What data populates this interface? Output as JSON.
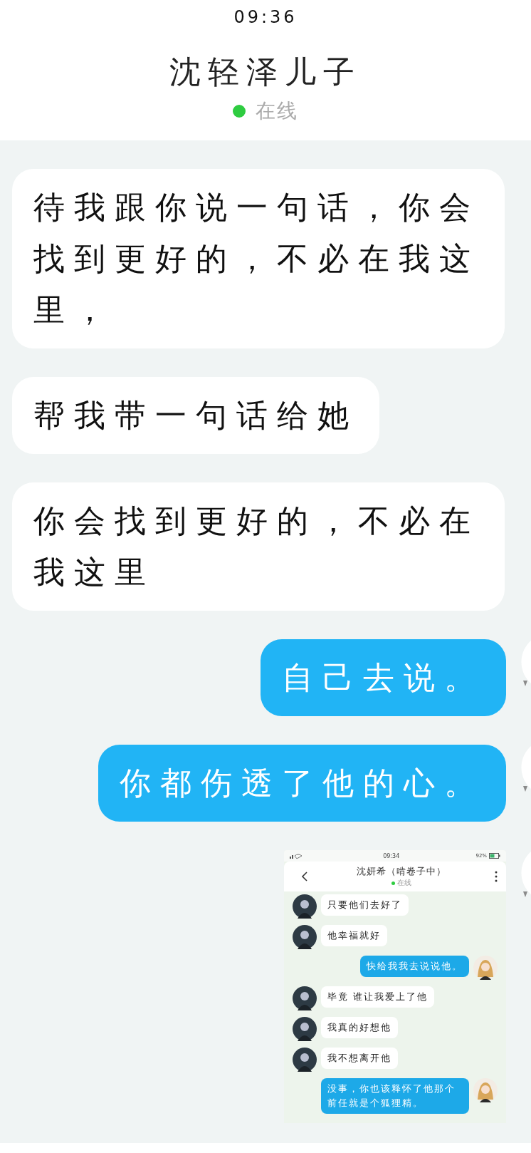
{
  "status_bar": {
    "time": "09:36"
  },
  "header": {
    "title": "沈轻泽儿子",
    "status": "在线",
    "online": true
  },
  "messages": [
    {
      "outgoing": false,
      "kind": "text",
      "text": "待我跟你说一句话，你会找到更好的，不必在我这里，"
    },
    {
      "outgoing": false,
      "kind": "text",
      "text": "帮我带一句话给她"
    },
    {
      "outgoing": false,
      "kind": "text",
      "text": "你会找到更好的，不必在我这里"
    },
    {
      "outgoing": true,
      "kind": "text",
      "text": "自己去说。"
    },
    {
      "outgoing": true,
      "kind": "text",
      "text": "你都伤透了他的心。"
    },
    {
      "outgoing": true,
      "kind": "screenshot",
      "screenshot": {
        "status_bar": {
          "time": "09:34",
          "battery": "92%"
        },
        "header": {
          "title": "沈妍希（啃卷子中）",
          "status": "在线",
          "online": true
        },
        "messages": [
          {
            "outgoing": false,
            "text": "只要他们去好了"
          },
          {
            "outgoing": false,
            "text": "他幸福就好"
          },
          {
            "outgoing": true,
            "text": "快给我我去说说他。"
          },
          {
            "outgoing": false,
            "text": "毕竟 谁让我爱上了他"
          },
          {
            "outgoing": false,
            "text": "我真的好想他"
          },
          {
            "outgoing": false,
            "text": "我不想离开他"
          },
          {
            "outgoing": true,
            "text": "没事，你也该释怀了他那个前任就是个狐狸精。"
          }
        ]
      }
    }
  ]
}
